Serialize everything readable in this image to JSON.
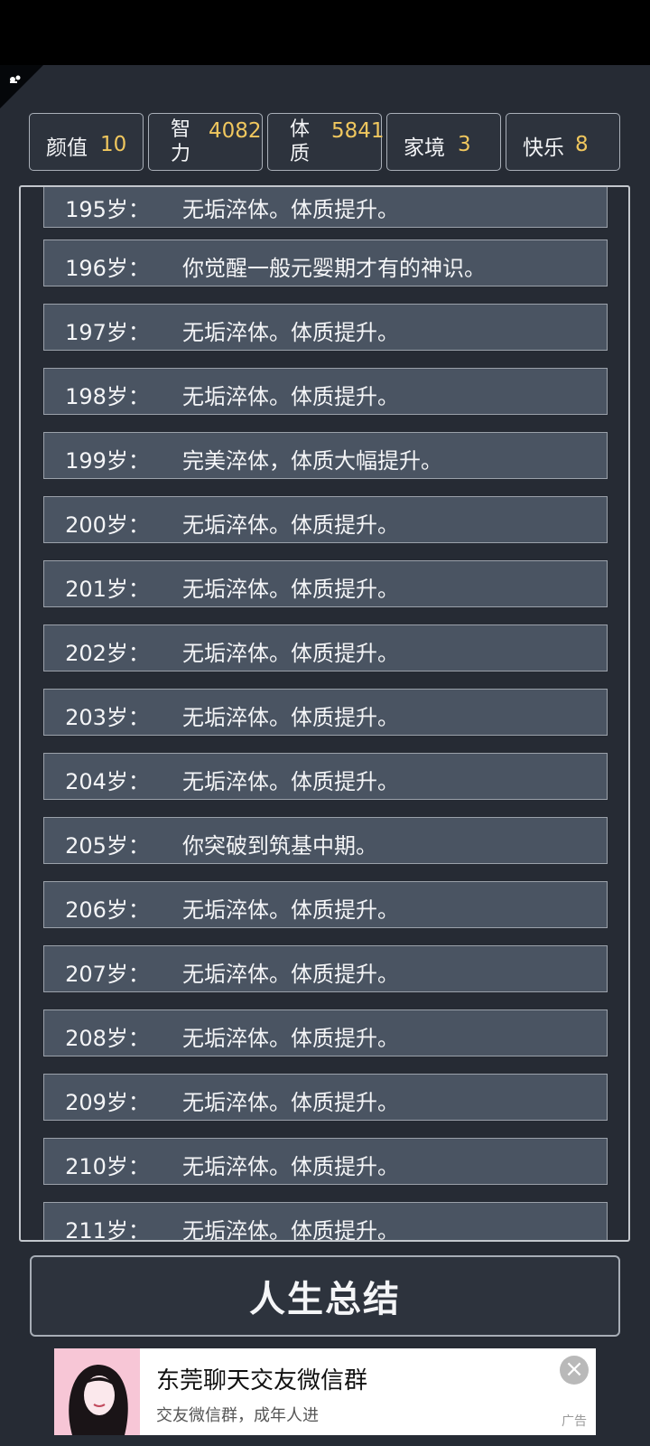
{
  "stats": [
    {
      "label": "颜值",
      "value": "10"
    },
    {
      "label": "智力",
      "value": "4082"
    },
    {
      "label": "体质",
      "value": "5841"
    },
    {
      "label": "家境",
      "value": "3"
    },
    {
      "label": "快乐",
      "value": "8"
    }
  ],
  "log": [
    {
      "age": "195岁：",
      "event": "无垢淬体。体质提升。"
    },
    {
      "age": "196岁：",
      "event": "你觉醒一般元婴期才有的神识。"
    },
    {
      "age": "197岁：",
      "event": "无垢淬体。体质提升。"
    },
    {
      "age": "198岁：",
      "event": "无垢淬体。体质提升。"
    },
    {
      "age": "199岁：",
      "event": "完美淬体，体质大幅提升。"
    },
    {
      "age": "200岁：",
      "event": "无垢淬体。体质提升。"
    },
    {
      "age": "201岁：",
      "event": "无垢淬体。体质提升。"
    },
    {
      "age": "202岁：",
      "event": "无垢淬体。体质提升。"
    },
    {
      "age": "203岁：",
      "event": "无垢淬体。体质提升。"
    },
    {
      "age": "204岁：",
      "event": "无垢淬体。体质提升。"
    },
    {
      "age": "205岁：",
      "event": "你突破到筑基中期。"
    },
    {
      "age": "206岁：",
      "event": "无垢淬体。体质提升。"
    },
    {
      "age": "207岁：",
      "event": "无垢淬体。体质提升。"
    },
    {
      "age": "208岁：",
      "event": "无垢淬体。体质提升。"
    },
    {
      "age": "209岁：",
      "event": "无垢淬体。体质提升。"
    },
    {
      "age": "210岁：",
      "event": "无垢淬体。体质提升。"
    },
    {
      "age": "211岁：",
      "event": "无垢淬体。体质提升。"
    }
  ],
  "summary_button": "人生总结",
  "ad": {
    "title": "东莞聊天交友微信群",
    "subtitle": "交友微信群，成年人进",
    "tag": "广告",
    "close": "×"
  },
  "colors": {
    "accent": "#f0c75e",
    "row_bg": "#4a5462",
    "page_bg": "#262b34"
  },
  "icons": [
    "pin-icon",
    "close-icon",
    "avatar-illustration"
  ]
}
